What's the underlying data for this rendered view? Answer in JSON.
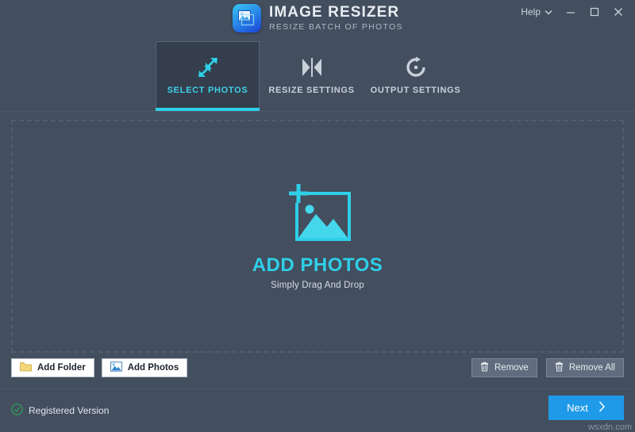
{
  "window": {
    "help_label": "Help",
    "controls": {
      "help_chevron_icon": "chevron-down-icon",
      "minimize_icon": "minimize-icon",
      "maximize_icon": "maximize-icon",
      "close_icon": "close-icon"
    }
  },
  "brand": {
    "logo_icon": "image-resizer-logo-icon",
    "title": "IMAGE RESIZER",
    "subtitle": "RESIZE BATCH OF PHOTOS"
  },
  "tabs": [
    {
      "label": "SELECT PHOTOS",
      "icon": "resize-arrows-icon",
      "active": true
    },
    {
      "label": "RESIZE SETTINGS",
      "icon": "bowtie-resize-icon",
      "active": false
    },
    {
      "label": "OUTPUT SETTINGS",
      "icon": "refresh-circle-icon",
      "active": false
    }
  ],
  "dropzone": {
    "icon": "add-photo-frame-icon",
    "title": "ADD PHOTOS",
    "subtitle": "Simply Drag And Drop"
  },
  "actions": {
    "add_folder": {
      "label": "Add Folder",
      "icon": "folder-icon"
    },
    "add_photos": {
      "label": "Add Photos",
      "icon": "photo-icon"
    },
    "remove": {
      "label": "Remove",
      "icon": "trash-icon"
    },
    "remove_all": {
      "label": "Remove All",
      "icon": "trash-icon"
    }
  },
  "footer": {
    "status": {
      "label": "Registered Version",
      "icon": "check-circle-icon"
    },
    "next": {
      "label": "Next",
      "icon": "chevron-right-icon"
    },
    "watermark": "wsxdn.com"
  },
  "colors": {
    "background": "#434e5e",
    "accent_cyan": "#2fcfe8",
    "accent_blue": "#1f9ae8",
    "tab_active_bg": "#343e4c",
    "status_green": "#2e9e5b",
    "dashed_border": "#525d6e"
  }
}
